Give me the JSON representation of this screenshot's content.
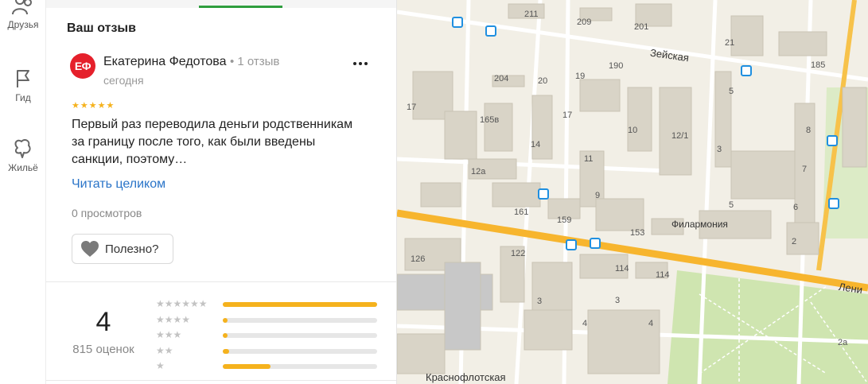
{
  "nav": {
    "items": [
      {
        "label": "Друзья",
        "icon": "friends-icon"
      },
      {
        "label": "Гид",
        "icon": "flag-icon"
      },
      {
        "label": "Жильё",
        "icon": "house-icon"
      }
    ]
  },
  "review_section": {
    "title": "Ваш отзыв",
    "author": {
      "initials": "ЕФ",
      "name": "Екатерина Федотова",
      "reviews_count": "1 отзыв",
      "date": "сегодня",
      "avatar_color": "#e5202b"
    },
    "rating_stars": "★★★★★",
    "text": "Первый раз переводила деньги родственникам за границу после того, как были введены санкции, поэтому…",
    "read_more": "Читать целиком",
    "views": "0 просмотров",
    "useful_label": "Полезно?"
  },
  "summary": {
    "rating": "4",
    "count": "815 оценок",
    "distribution": [
      {
        "stars": "★★★★★★",
        "fraction": 1.0
      },
      {
        "stars": "★★★★",
        "fraction": 0.03
      },
      {
        "stars": "★★★",
        "fraction": 0.03
      },
      {
        "stars": "★★",
        "fraction": 0.04
      },
      {
        "stars": "★",
        "fraction": 0.31
      }
    ],
    "accent_color": "#f5b21d"
  },
  "map": {
    "streets": [
      "Зейская",
      "Лени",
      "Краснофлотская"
    ],
    "poi": [
      "Филармония"
    ],
    "house_numbers": [
      "211",
      "209",
      "201",
      "21",
      "185",
      "204",
      "20",
      "19",
      "190",
      "17",
      "165в",
      "17",
      "14",
      "10",
      "12/1",
      "5",
      "3",
      "8",
      "7",
      "11",
      "12а",
      "9",
      "161",
      "159",
      "153",
      "6",
      "2",
      "126",
      "122",
      "114",
      "114",
      "3",
      "3",
      "4",
      "4",
      "2а",
      "5"
    ]
  }
}
